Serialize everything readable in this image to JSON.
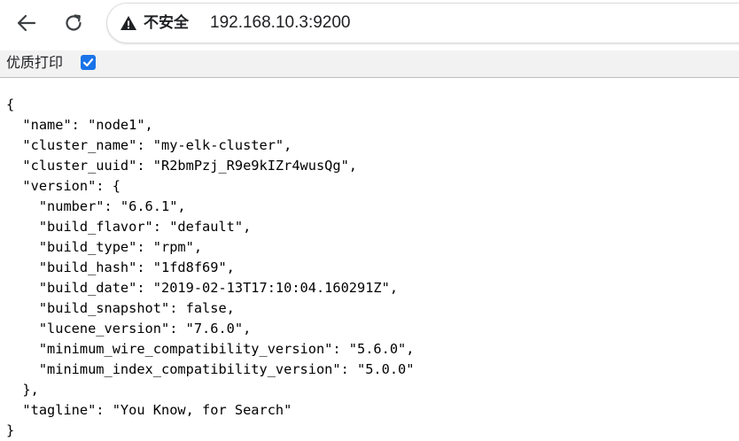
{
  "browser": {
    "security_label": "不安全",
    "url": "192.168.10.3:9200"
  },
  "print_bar": {
    "label": "优质打印",
    "checked": true
  },
  "json_lines": [
    "{",
    "  \"name\": \"node1\",",
    "  \"cluster_name\": \"my-elk-cluster\",",
    "  \"cluster_uuid\": \"R2bmPzj_R9e9kIZr4wusQg\",",
    "  \"version\": {",
    "    \"number\": \"6.6.1\",",
    "    \"build_flavor\": \"default\",",
    "    \"build_type\": \"rpm\",",
    "    \"build_hash\": \"1fd8f69\",",
    "    \"build_date\": \"2019-02-13T17:10:04.160291Z\",",
    "    \"build_snapshot\": false,",
    "    \"lucene_version\": \"7.6.0\",",
    "    \"minimum_wire_compatibility_version\": \"5.6.0\",",
    "    \"minimum_index_compatibility_version\": \"5.0.0\"",
    "  },",
    "  \"tagline\": \"You Know, for Search\"",
    "}"
  ]
}
